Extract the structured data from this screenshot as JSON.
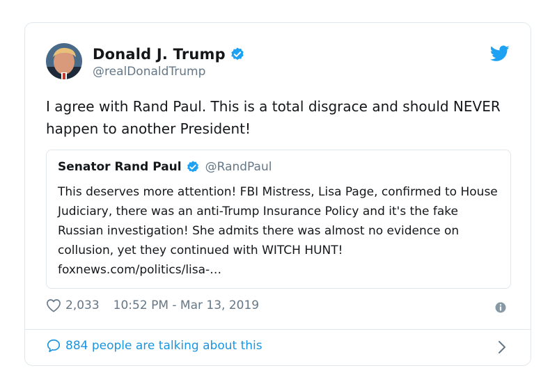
{
  "author": {
    "display_name": "Donald J. Trump",
    "handle": "@realDonaldTrump",
    "verified": true,
    "avatar_icon": "profile-photo"
  },
  "tweet": {
    "text": "I agree with Rand Paul. This is a total disgrace and should NEVER happen to another President!"
  },
  "quoted_tweet": {
    "display_name": "Senator Rand Paul",
    "handle": "@RandPaul",
    "verified": true,
    "text": "This deserves more attention! FBI Mistress, Lisa Page, confirmed to House Judiciary, there was an anti-Trump Insurance Policy and it's the fake Russian investigation! She admits there was almost no evidence on collusion, yet they continued with WITCH HUNT! foxnews.com/politics/lisa-…"
  },
  "meta": {
    "likes": "2,033",
    "timestamp": "10:52 PM - Mar 13, 2019"
  },
  "footer": {
    "talking_label": "884 people are talking about this"
  },
  "colors": {
    "brand_blue": "#1da1f2",
    "link_blue": "#1b95e0",
    "secondary_text": "#657786",
    "border": "#e1e8ed"
  }
}
